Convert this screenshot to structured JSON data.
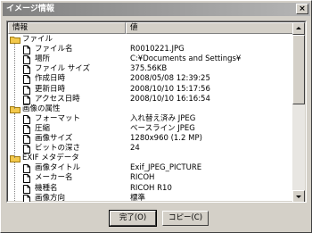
{
  "window": {
    "title": "イメージ情報",
    "close_label": "×"
  },
  "columns": {
    "name": "情報",
    "value": "値"
  },
  "rows": [
    {
      "type": "category",
      "name": "ファイル",
      "value": ""
    },
    {
      "type": "item",
      "name": "ファイル名",
      "value": "R0010221.JPG"
    },
    {
      "type": "item",
      "name": "場所",
      "value": "C:¥Documents and Settings¥"
    },
    {
      "type": "item",
      "name": "ファイル サイズ",
      "value": "375.56KB"
    },
    {
      "type": "item",
      "name": "作成日時",
      "value": "2008/05/08 12:39:25"
    },
    {
      "type": "item",
      "name": "更新日時",
      "value": "2008/10/10 15:17:56"
    },
    {
      "type": "item",
      "name": "アクセス日時",
      "value": "2008/10/10 16:16:54"
    },
    {
      "type": "category",
      "name": "画像の属性",
      "value": ""
    },
    {
      "type": "item",
      "name": "フォーマット",
      "value": "入れ替え済み JPEG"
    },
    {
      "type": "item",
      "name": "圧縮",
      "value": "ベースライン JPEG"
    },
    {
      "type": "item",
      "name": "画像サイズ",
      "value": "1280x960 (1.2 MP)"
    },
    {
      "type": "item",
      "name": "ビットの深さ",
      "value": "24"
    },
    {
      "type": "category",
      "name": "EXIF メタデータ",
      "value": ""
    },
    {
      "type": "item",
      "name": "画像タイトル",
      "value": "Exif_JPEG_PICTURE"
    },
    {
      "type": "item",
      "name": "メーカー名",
      "value": "RICOH"
    },
    {
      "type": "item",
      "name": "機種名",
      "value": "RICOH R10"
    },
    {
      "type": "item",
      "name": "画像方向",
      "value": "標準"
    }
  ],
  "buttons": {
    "ok": "完了(O)",
    "copy": "コピー(C)"
  },
  "colors": {
    "folder": "#f3c84b",
    "folder_edge": "#a07b12",
    "titlebar_start": "#808080",
    "titlebar_end": "#b5b5b5"
  }
}
